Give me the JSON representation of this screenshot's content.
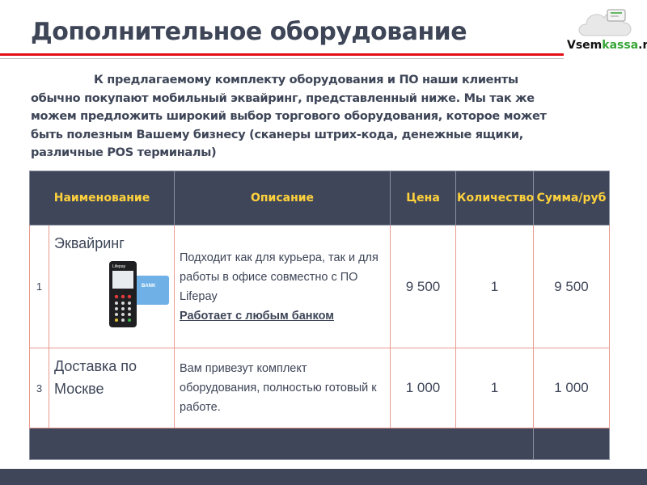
{
  "header": {
    "title": "Дополнительное оборудование"
  },
  "logo": {
    "brand_main": "Vsem",
    "brand_accent": "kassa",
    "brand_suffix": ".ru"
  },
  "intro": {
    "text": "К предлагаемому комплекту оборудования и ПО наши клиенты обычно покупают мобильный эквайринг, представленный ниже. Мы так же можем предложить широкий выбор торгового оборудования, которое может быть полезным Вашему бизнесу (сканеры штрих-кода, денежные ящики, различные POS терминалы)"
  },
  "table": {
    "headers": [
      "Наименование",
      "Описание",
      "Цена",
      "Количество",
      "Сумма/руб"
    ],
    "rows": [
      {
        "num": "1",
        "name": "Эквайринг",
        "description": "Подходит как для курьера, так и для работы в офисе совместно с ПО Lifepay",
        "description_emphasis": "Работает с любым банком",
        "price": "9 500",
        "quantity": "1",
        "sum": "9 500",
        "image": {
          "icon": "card-terminal-icon",
          "device_label": "Lifepay",
          "card_label": "BANK"
        }
      },
      {
        "num": "3",
        "name": "Доставка по Москве",
        "description": "Вам привезут комплект оборудования, полностью готовый к работе.",
        "price": "1 000",
        "quantity": "1",
        "sum": "1 000"
      }
    ]
  },
  "colors": {
    "title": "#3d4557",
    "header_bg": "#3f4659",
    "header_text": "#ffd23c",
    "accent_line": "#e30f17",
    "cell_border": "#ea9a8e"
  }
}
